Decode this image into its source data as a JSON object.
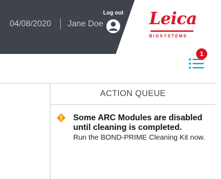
{
  "header": {
    "date": "04/08/2020",
    "user": "Jane Doe",
    "logout_label": "Log out",
    "brand_name": "Leica",
    "brand_sub": "BIOSYSTEMS"
  },
  "notifications": {
    "count": "1"
  },
  "action_queue": {
    "title": "ACTION QUEUE",
    "alert_title": "Some ARC Modules are disabled until cleaning is completed.",
    "alert_body": "Run the BOND-PRIME Cleaning Kit now."
  },
  "colors": {
    "header_dark": "#3f434b",
    "brand_red": "#d9182d",
    "badge_red": "#d7161f",
    "warning_orange": "#f39b1d",
    "menu_blue": "#2aa7d8"
  },
  "icons": [
    "logout-icon",
    "menu-list-icon",
    "warning-icon"
  ]
}
